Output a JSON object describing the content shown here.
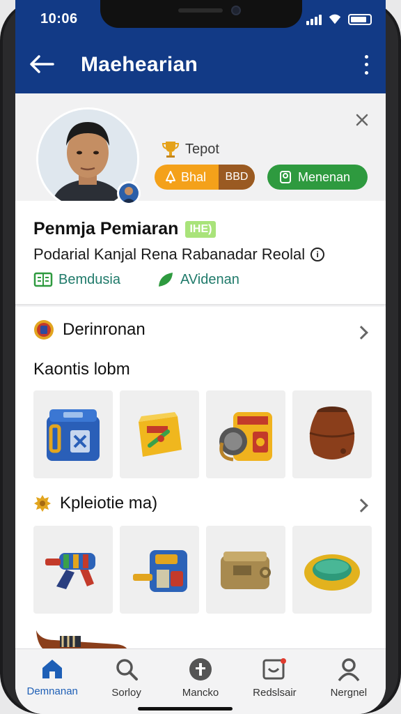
{
  "status": {
    "time": "10:06"
  },
  "appbar": {
    "title": "Maehearian",
    "back_icon": "arrow-left-icon",
    "more_icon": "more-vertical-icon"
  },
  "profile": {
    "trophy_label": "Tepot",
    "pill_orange": {
      "label": "Bhal",
      "value": "BBD"
    },
    "pill_green": {
      "label": "Menenan"
    },
    "name": "Penmja Pemiaran",
    "tag": "IHE)",
    "subtitle": "Podarial Kanjal Rena Rabanadar Reolal",
    "links": [
      {
        "label": "Bemdusia",
        "icon": "book-icon"
      },
      {
        "label": "AVidenan",
        "icon": "leaf-icon"
      }
    ]
  },
  "section1": {
    "title": "Derinronan",
    "subtitle": "Kaontis lobm"
  },
  "section2": {
    "title": "Kpleiotie ma)"
  },
  "nav": [
    {
      "label": "Demnanan",
      "icon": "home-icon",
      "active": true
    },
    {
      "label": "Sorloy",
      "icon": "search-icon",
      "active": false
    },
    {
      "label": "Mancko",
      "icon": "info-icon",
      "active": false
    },
    {
      "label": "Redslsair",
      "icon": "message-icon",
      "active": false
    },
    {
      "label": "Nergnel",
      "icon": "person-icon",
      "active": false
    }
  ],
  "colors": {
    "primary": "#123a86",
    "orange": "#f4a11a",
    "green": "#2e9a3f",
    "link": "#1f7a6a"
  }
}
